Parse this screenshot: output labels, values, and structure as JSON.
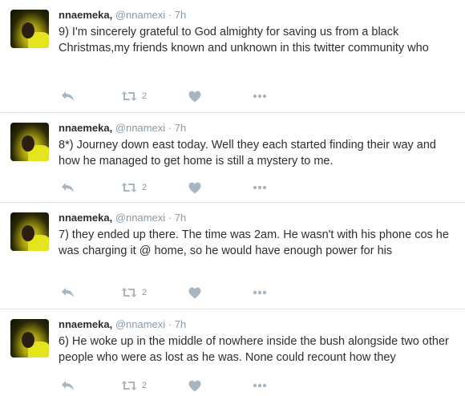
{
  "tweets": [
    {
      "author": "nnaemeka,",
      "handle": "@nnamexi",
      "separator": "·",
      "time": "7h",
      "text": "9) I'm sincerely grateful to God almighty for saving us from a black Christmas,my friends known and unknown in this twitter community who",
      "retweet_count": "2"
    },
    {
      "author": "nnaemeka,",
      "handle": "@nnamexi",
      "separator": "·",
      "time": "7h",
      "text": "8*) Journey down east today. Well they each started finding their way and how he managed to get home is still a mystery to me.",
      "retweet_count": "2"
    },
    {
      "author": "nnaemeka,",
      "handle": "@nnamexi",
      "separator": "·",
      "time": "7h",
      "text": "7) they ended up there. The time was 2am. He wasn't with his phone cos he was charging it @ home, so he would have enough power for his",
      "retweet_count": "2"
    },
    {
      "author": "nnaemeka,",
      "handle": "@nnamexi",
      "separator": "·",
      "time": "7h",
      "text": "6) He woke up in the middle of nowhere inside the bush alongside two other people who were as lost as he was. None could recount how they",
      "retweet_count": "2"
    }
  ],
  "icons": {
    "reply": "reply-icon",
    "retweet": "retweet-icon",
    "like": "heart-icon",
    "more": "more-icon"
  },
  "colors": {
    "icon": "#a8b6c2",
    "secondary_text": "#8899a6",
    "primary_text": "#292f33",
    "divider": "#e1e8ed"
  }
}
